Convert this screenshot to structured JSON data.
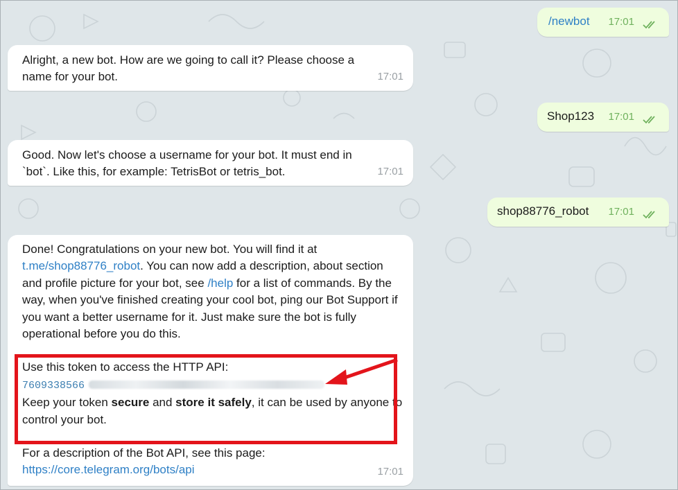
{
  "colors": {
    "chat_background": "#dfe6e9",
    "incoming_bubble": "#ffffff",
    "outgoing_bubble": "#effdde",
    "link": "#2f80c6",
    "outgoing_time": "#6fb15d",
    "highlight": "#e3141b"
  },
  "messages": {
    "m1": {
      "text": "/newbot",
      "time": "17:01",
      "status_icon": "double-check-icon"
    },
    "m2": {
      "text": "Alright, a new bot. How are we going to call it? Please choose a name for your bot.",
      "time": "17:01"
    },
    "m3": {
      "text": "Shop123",
      "time": "17:01",
      "status_icon": "double-check-icon"
    },
    "m4": {
      "text": "Good. Now let's choose a username for your bot. It must end in `bot`. Like this, for example: TetrisBot or tetris_bot.",
      "time": "17:01"
    },
    "m5": {
      "text": "shop88776_robot",
      "time": "17:01",
      "status_icon": "double-check-icon"
    },
    "m6": {
      "p1_a": "Done! Congratulations on your new bot. You will find it at ",
      "p1_link": "t.me/shop88776_robot",
      "p1_b": ". You can now add a description, about section and profile picture for your bot, see ",
      "p1_help": "/help",
      "p1_c": " for a list of commands. By the way, when you've finished creating your cool bot, ping our Bot Support if you want a better username for it. Just make sure the bot is fully operational before you do this.",
      "token_heading": "Use this token to access the HTTP API:",
      "token_visible": "7609338566",
      "keep_a": "Keep your token ",
      "keep_secure": "secure",
      "keep_b": " and ",
      "keep_store": "store it safely",
      "keep_c": ", it can be used by anyone to control your bot.",
      "api_intro": "For a description of the Bot API, see this page:",
      "api_link": "https://core.telegram.org/bots/api",
      "time": "17:01"
    }
  }
}
